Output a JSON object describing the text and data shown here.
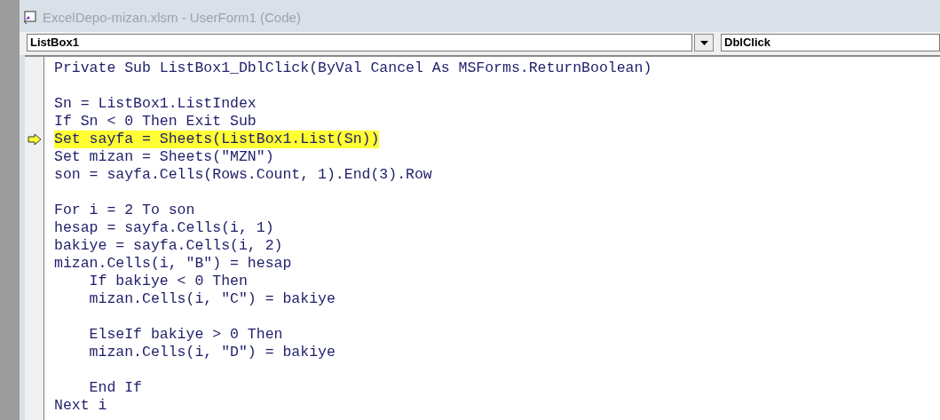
{
  "window": {
    "title": "ExcelDepo-mizan.xlsm - UserForm1 (Code)"
  },
  "object_dropdown": {
    "value": "ListBox1"
  },
  "procedure_dropdown": {
    "value": "DblClick"
  },
  "code_lines": [
    {
      "kind": "code",
      "text": "Private Sub ListBox1_DblClick(ByVal Cancel As MSForms.ReturnBoolean)",
      "current": false
    },
    {
      "kind": "blank"
    },
    {
      "kind": "code",
      "text": "Sn = ListBox1.ListIndex",
      "current": false
    },
    {
      "kind": "code",
      "text": "If Sn < 0 Then Exit Sub",
      "current": false
    },
    {
      "kind": "code",
      "text": "Set sayfa = Sheets(ListBox1.List(Sn))",
      "current": true
    },
    {
      "kind": "code",
      "text": "Set mizan = Sheets(\"MZN\")",
      "current": false
    },
    {
      "kind": "code",
      "text": "son = sayfa.Cells(Rows.Count, 1).End(3).Row",
      "current": false
    },
    {
      "kind": "blank"
    },
    {
      "kind": "code",
      "text": "For i = 2 To son",
      "current": false
    },
    {
      "kind": "code",
      "text": "hesap = sayfa.Cells(i, 1)",
      "current": false
    },
    {
      "kind": "code",
      "text": "bakiye = sayfa.Cells(i, 2)",
      "current": false
    },
    {
      "kind": "code",
      "text": "mizan.Cells(i, \"B\") = hesap",
      "current": false
    },
    {
      "kind": "code",
      "text": "    If bakiye < 0 Then",
      "current": false
    },
    {
      "kind": "code",
      "text": "    mizan.Cells(i, \"C\") = bakiye",
      "current": false
    },
    {
      "kind": "blank"
    },
    {
      "kind": "code",
      "text": "    ElseIf bakiye > 0 Then",
      "current": false
    },
    {
      "kind": "code",
      "text": "    mizan.Cells(i, \"D\") = bakiye",
      "current": false
    },
    {
      "kind": "blank"
    },
    {
      "kind": "code",
      "text": "    End If",
      "current": false
    },
    {
      "kind": "code",
      "text": "Next i",
      "current": false
    }
  ]
}
